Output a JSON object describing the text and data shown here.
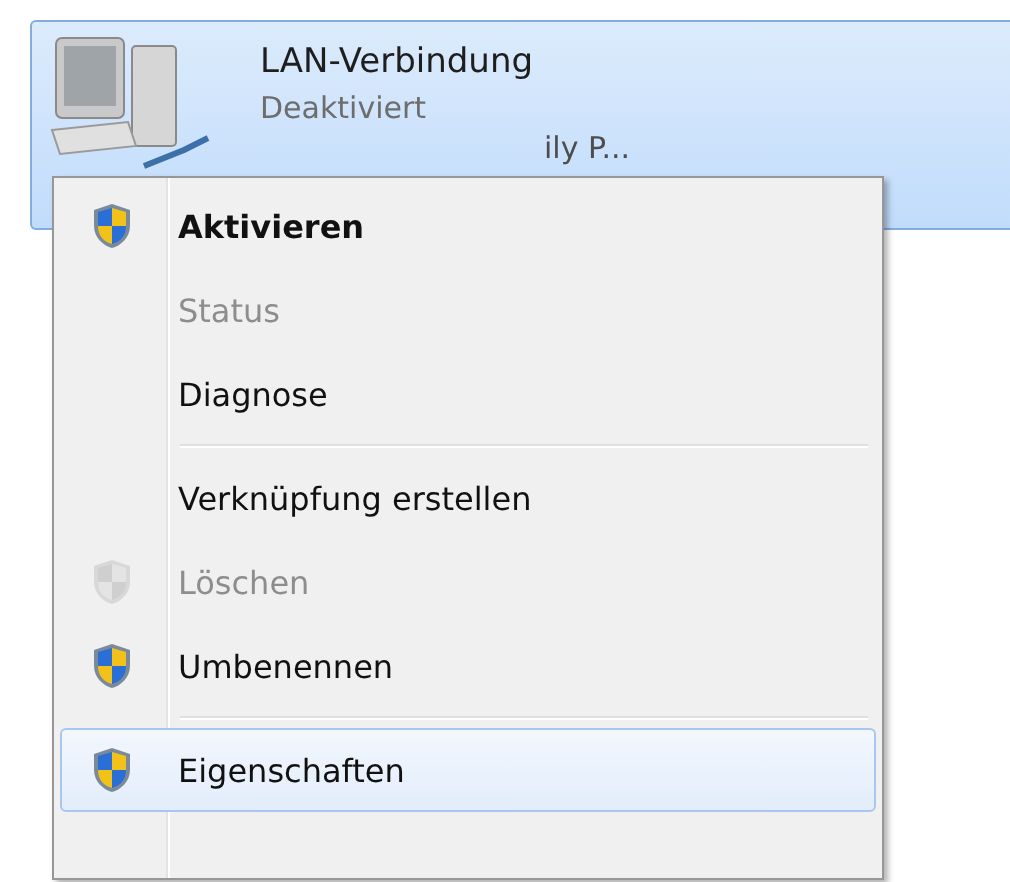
{
  "connection": {
    "name": "LAN-Verbindung",
    "status": "Deaktiviert",
    "device_visible_part": "ily P...",
    "selected": true
  },
  "context_menu": {
    "items": [
      {
        "kind": "shield_item",
        "label": "Aktivieren",
        "default": true,
        "disabled": false,
        "selected": false
      },
      {
        "kind": "item",
        "label": "Status",
        "default": false,
        "disabled": true,
        "selected": false
      },
      {
        "kind": "item",
        "label": "Diagnose",
        "default": false,
        "disabled": false,
        "selected": false
      },
      {
        "kind": "separator"
      },
      {
        "kind": "item",
        "label": "Verknüpfung erstellen",
        "default": false,
        "disabled": false,
        "selected": false
      },
      {
        "kind": "shield_item",
        "label": "Löschen",
        "default": false,
        "disabled": true,
        "selected": false
      },
      {
        "kind": "shield_item",
        "label": "Umbenennen",
        "default": false,
        "disabled": false,
        "selected": false
      },
      {
        "kind": "separator"
      },
      {
        "kind": "shield_item",
        "label": "Eigenschaften",
        "default": false,
        "disabled": false,
        "selected": true
      }
    ]
  }
}
